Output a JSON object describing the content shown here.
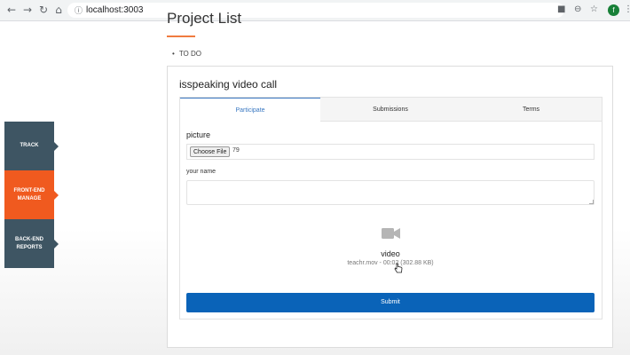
{
  "browser": {
    "url": "localhost:3003",
    "avatar_letter": "f"
  },
  "sidebar": {
    "items": [
      {
        "label": "TRACK"
      },
      {
        "label": "FRONT-END MANAGE"
      },
      {
        "label": "BACK-END REPORTS"
      }
    ]
  },
  "page": {
    "title": "Project List",
    "list_item": "TO DO"
  },
  "card": {
    "title": "isspeaking video call",
    "tabs": [
      {
        "label": "Participate",
        "active": true
      },
      {
        "label": "Submissions",
        "active": false
      },
      {
        "label": "Terms",
        "active": false
      }
    ],
    "picture_label": "picture",
    "choose_file_label": "Choose File",
    "file_name": "79",
    "name_label": "your name",
    "name_value": "",
    "video_label": "video",
    "video_meta": "teachr.mov - 00:02 (302.88 KB)",
    "submit_label": "Submit"
  },
  "colors": {
    "accent": "#f05a1f",
    "sidebar_dark": "#3e5563",
    "submit_blue": "#0a63b8",
    "tab_active": "#3a78c2"
  }
}
